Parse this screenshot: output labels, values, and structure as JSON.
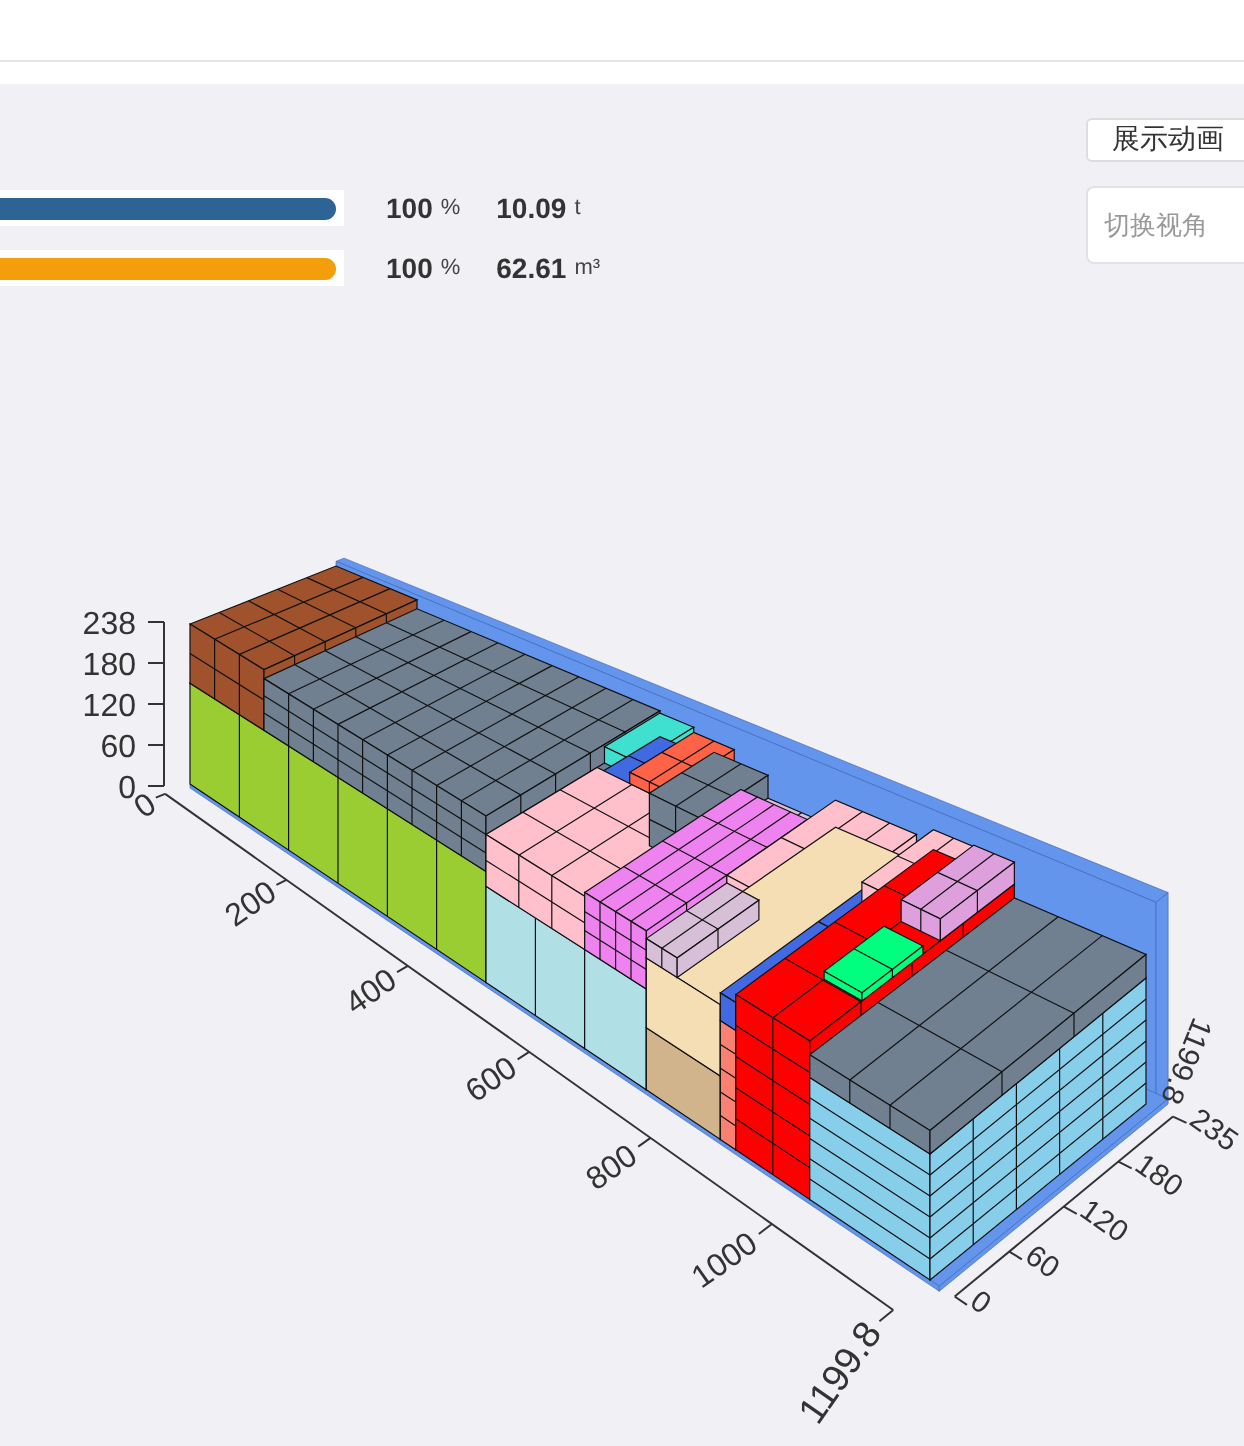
{
  "metrics": [
    {
      "color": "#2c6496",
      "level": 1,
      "percent": "100",
      "percent_unit": "%",
      "value": "10.09",
      "unit": "t"
    },
    {
      "color": "#f59e0b",
      "level": 1,
      "percent": "100",
      "percent_unit": "%",
      "value": "62.61",
      "unit": "m³"
    }
  ],
  "controls": {
    "animate_button": "展示动画",
    "view_select": {
      "placeholder": "切换视角"
    }
  },
  "plot": {
    "height_axis": [
      "238",
      "180",
      "120",
      "60",
      "0"
    ],
    "length_axis": [
      "0",
      "200",
      "400",
      "600",
      "800",
      "1000",
      "1199.8"
    ],
    "width_axis": [
      "0",
      "60",
      "120",
      "180",
      "235"
    ],
    "end_label": "1199.8"
  }
}
